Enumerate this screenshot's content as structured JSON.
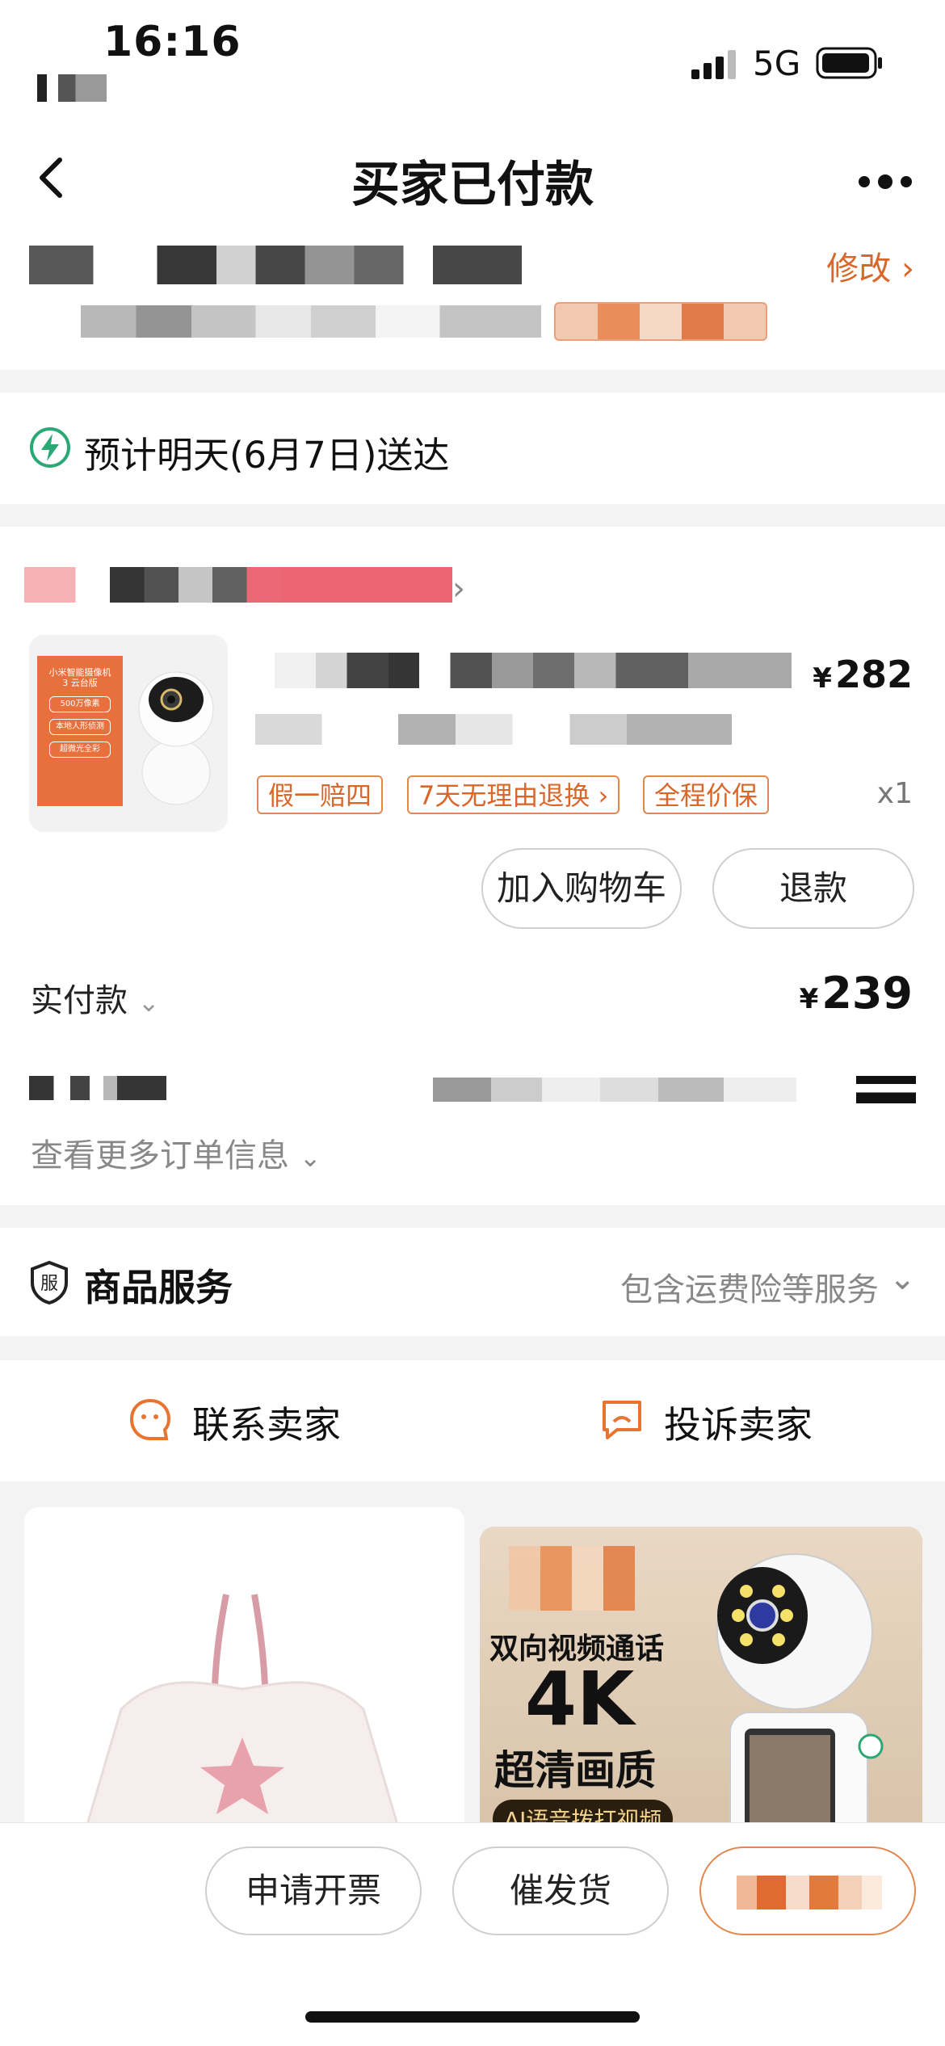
{
  "status_bar": {
    "time": "16:16",
    "network": "5G"
  },
  "header": {
    "title": "买家已付款"
  },
  "address": {
    "edit_label": "修改"
  },
  "delivery": {
    "text": "预计明天(6月7日)送达"
  },
  "product": {
    "price": "282",
    "currency": "¥",
    "tags": [
      "假一赔四",
      "7天无理由退换",
      "全程价保"
    ],
    "quantity": "x1",
    "thumb_text": {
      "title": "小米智能摄像机\n3 云台版",
      "badges": [
        "500万像素",
        "本地人形侦测",
        "超微光全彩"
      ]
    },
    "add_to_cart_label": "加入购物车",
    "refund_label": "退款"
  },
  "payment": {
    "label": "实付款",
    "currency": "¥",
    "amount": "239",
    "more_info_label": "查看更多订单信息"
  },
  "service": {
    "title": "商品服务",
    "icon_text": "服",
    "desc": "包含运费险等服务"
  },
  "contact": {
    "contact_seller": "联系卖家",
    "complain_seller": "投诉卖家"
  },
  "promo": {
    "line1": "双向视频通话",
    "line2": "4K",
    "line3": "超清画质",
    "line4": "AI语音拨打视频"
  },
  "bottom_bar": {
    "invoice_label": "申请开票",
    "urge_label": "催发货"
  },
  "colors": {
    "accent": "#d9672a",
    "background": "#f3f3f3"
  }
}
